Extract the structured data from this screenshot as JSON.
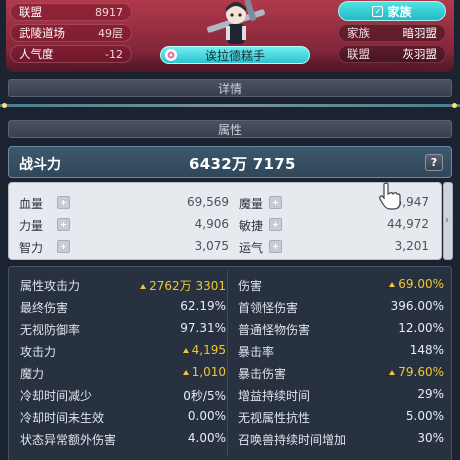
{
  "banner": {
    "left_stats": [
      {
        "label": "联盟",
        "value": "8917"
      },
      {
        "label": "武陵道场",
        "value": "49层"
      },
      {
        "label": "人气度",
        "value": "-12"
      }
    ],
    "guild_button": "家族",
    "right_stats": [
      {
        "label": "家族",
        "value": "暗羽盟"
      },
      {
        "label": "联盟",
        "value": "灰羽盟"
      }
    ],
    "title_badge": "诶拉德糕手"
  },
  "sections": {
    "details": "详情",
    "attributes": "属性"
  },
  "power": {
    "label": "战斗力",
    "value": "6432万 7175",
    "help": "?"
  },
  "base_stats": [
    {
      "label": "血量",
      "value": "69,569"
    },
    {
      "label": "魔量",
      "value": "5,947"
    },
    {
      "label": "力量",
      "value": "4,906"
    },
    {
      "label": "敏捷",
      "value": "44,972"
    },
    {
      "label": "智力",
      "value": "3,075"
    },
    {
      "label": "运气",
      "value": "3,201"
    }
  ],
  "detail_stats_left": [
    {
      "label": "属性攻击力",
      "value": "2762万 3301",
      "up": true
    },
    {
      "label": "最终伤害",
      "value": "62.19%",
      "up": false
    },
    {
      "label": "无视防御率",
      "value": "97.31%",
      "up": false
    },
    {
      "label": "攻击力",
      "value": "4,195",
      "up": true
    },
    {
      "label": "魔力",
      "value": "1,010",
      "up": true
    },
    {
      "label": "冷却时间减少",
      "value": "0秒/5%",
      "up": false
    },
    {
      "label": "冷却时间未生效",
      "value": "0.00%",
      "up": false
    },
    {
      "label": "状态异常额外伤害",
      "value": "4.00%",
      "up": false
    }
  ],
  "detail_stats_right": [
    {
      "label": "伤害",
      "value": "69.00%",
      "up": true
    },
    {
      "label": "首领怪伤害",
      "value": "396.00%",
      "up": false
    },
    {
      "label": "普通怪物伤害",
      "value": "12.00%",
      "up": false
    },
    {
      "label": "暴击率",
      "value": "148%",
      "up": false
    },
    {
      "label": "暴击伤害",
      "value": "79.60%",
      "up": true
    },
    {
      "label": "增益持续时间",
      "value": "29%",
      "up": false
    },
    {
      "label": "无视属性抗性",
      "value": "5.00%",
      "up": false
    },
    {
      "label": "召唤兽持续时间增加",
      "value": "30%",
      "up": false
    }
  ],
  "colors": {
    "banner": "#9e3246",
    "accent_cyan": "#2dc3d0",
    "gold": "#f3c531",
    "panel_dark": "#283140"
  }
}
